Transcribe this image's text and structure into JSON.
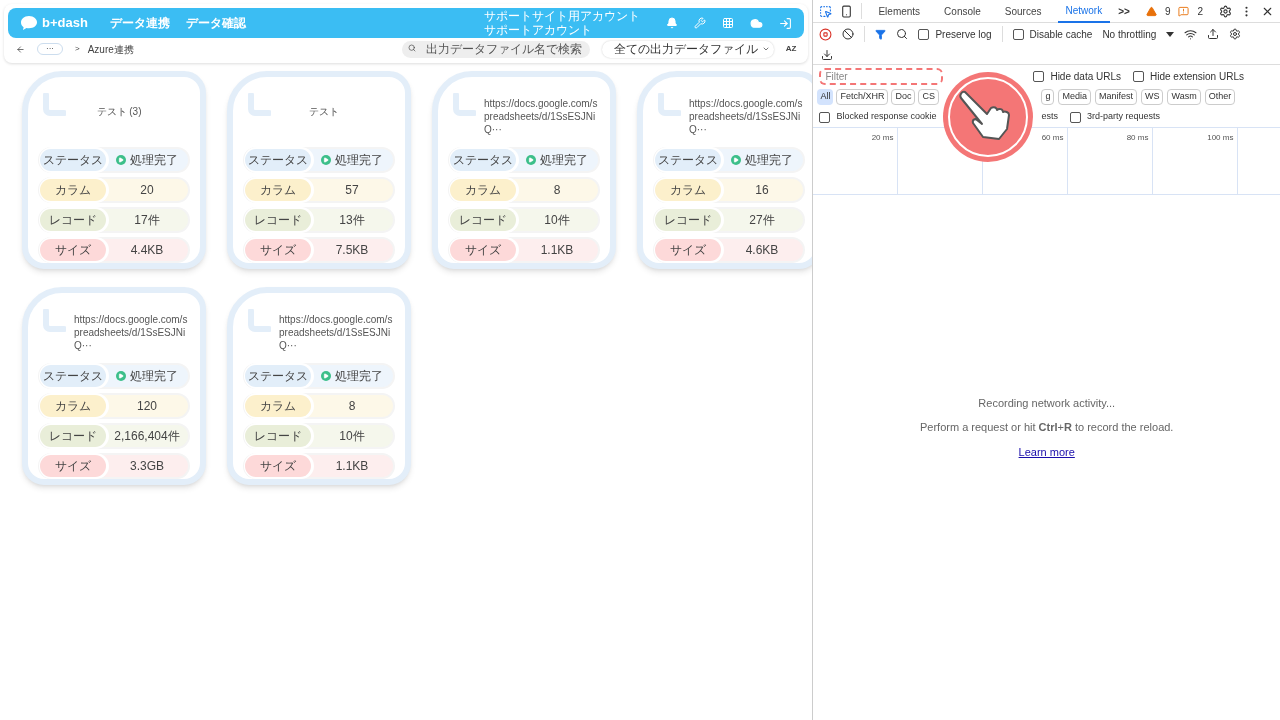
{
  "app": {
    "logo": "b+dash",
    "nav": [
      "データ連携",
      "データ確認"
    ],
    "account": [
      "サポートサイト用アカウント",
      "サポートアカウント"
    ]
  },
  "breadcrumb": {
    "more": "···",
    "separator": ">",
    "current": "Azure連携"
  },
  "search": {
    "placeholder": "出力データファイル名で検索"
  },
  "filter_dropdown": {
    "value": "全ての出力データファイル"
  },
  "sort_label": "AZ",
  "cards": [
    {
      "title": "テスト (3)",
      "rows": [
        {
          "kind": "status",
          "label": "ステータス",
          "value": "処理完了"
        },
        {
          "kind": "column",
          "label": "カラム",
          "value": "20"
        },
        {
          "kind": "record",
          "label": "レコード",
          "value": "17件"
        },
        {
          "kind": "size",
          "label": "サイズ",
          "value": "4.4KB"
        }
      ]
    },
    {
      "title": "テスト",
      "rows": [
        {
          "kind": "status",
          "label": "ステータス",
          "value": "処理完了"
        },
        {
          "kind": "column",
          "label": "カラム",
          "value": "57"
        },
        {
          "kind": "record",
          "label": "レコード",
          "value": "13件"
        },
        {
          "kind": "size",
          "label": "サイズ",
          "value": "7.5KB"
        }
      ]
    },
    {
      "title": "https://docs.google.com/spreadsheets/d/1SsESJNiQ···",
      "rows": [
        {
          "kind": "status",
          "label": "ステータス",
          "value": "処理完了"
        },
        {
          "kind": "column",
          "label": "カラム",
          "value": "8"
        },
        {
          "kind": "record",
          "label": "レコード",
          "value": "10件"
        },
        {
          "kind": "size",
          "label": "サイズ",
          "value": "1.1KB"
        }
      ]
    },
    {
      "title": "https://docs.google.com/spreadsheets/d/1SsESJNiQ···",
      "rows": [
        {
          "kind": "status",
          "label": "ステータス",
          "value": "処理完了"
        },
        {
          "kind": "column",
          "label": "カラム",
          "value": "16"
        },
        {
          "kind": "record",
          "label": "レコード",
          "value": "27件"
        },
        {
          "kind": "size",
          "label": "サイズ",
          "value": "4.6KB"
        }
      ]
    },
    {
      "title": "https://docs.google.com/spreadsheets/d/1SsESJNiQ···",
      "rows": [
        {
          "kind": "status",
          "label": "ステータス",
          "value": "処理完了"
        },
        {
          "kind": "column",
          "label": "カラム",
          "value": "120"
        },
        {
          "kind": "record",
          "label": "レコード",
          "value": "2,166,404件"
        },
        {
          "kind": "size",
          "label": "サイズ",
          "value": "3.3GB"
        }
      ]
    },
    {
      "title": "https://docs.google.com/spreadsheets/d/1SsESJNiQ···",
      "rows": [
        {
          "kind": "status",
          "label": "ステータス",
          "value": "処理完了"
        },
        {
          "kind": "column",
          "label": "カラム",
          "value": "8"
        },
        {
          "kind": "record",
          "label": "レコード",
          "value": "10件"
        },
        {
          "kind": "size",
          "label": "サイズ",
          "value": "1.1KB"
        }
      ]
    }
  ],
  "devtools": {
    "tabs": [
      {
        "label": "Elements",
        "selected": false
      },
      {
        "label": "Console",
        "selected": false
      },
      {
        "label": "Sources",
        "selected": false
      },
      {
        "label": "Network",
        "selected": true
      }
    ],
    "more_tabs": ">>",
    "warnings": "9",
    "errors": "2",
    "preserve_log": {
      "label": "Preserve log",
      "checked": false
    },
    "disable_cache": {
      "label": "Disable cache",
      "checked": false
    },
    "throttling": "No throttling",
    "filter": {
      "placeholder": "Filter"
    },
    "url_filters": [
      {
        "label": "Hide data URLs",
        "checked": false
      },
      {
        "label": "Hide extension URLs",
        "checked": false
      }
    ],
    "types": [
      {
        "label": "All",
        "selected": true
      },
      {
        "label": "Fetch/XHR",
        "selected": false
      },
      {
        "label": "Doc",
        "selected": false
      },
      {
        "label": "CS",
        "selected": false
      },
      {
        "label": "g",
        "selected": false
      },
      {
        "label": "Media",
        "selected": false
      },
      {
        "label": "Manifest",
        "selected": false
      },
      {
        "label": "WS",
        "selected": false
      },
      {
        "label": "Wasm",
        "selected": false
      },
      {
        "label": "Other",
        "selected": false
      }
    ],
    "request_filters": [
      {
        "label": "Blocked response cookie",
        "checked": false
      },
      {
        "label": "3rd-party requests",
        "checked": false
      }
    ],
    "request_filters_fragment": "ests",
    "timeline_ticks": [
      "20 ms",
      "60 ms",
      "80 ms",
      "100 ms"
    ],
    "empty": {
      "title": "Recording network activity...",
      "hint": "Perform a request or hit **Ctrl**+**R** to record the reload.",
      "link": "Learn more"
    }
  }
}
